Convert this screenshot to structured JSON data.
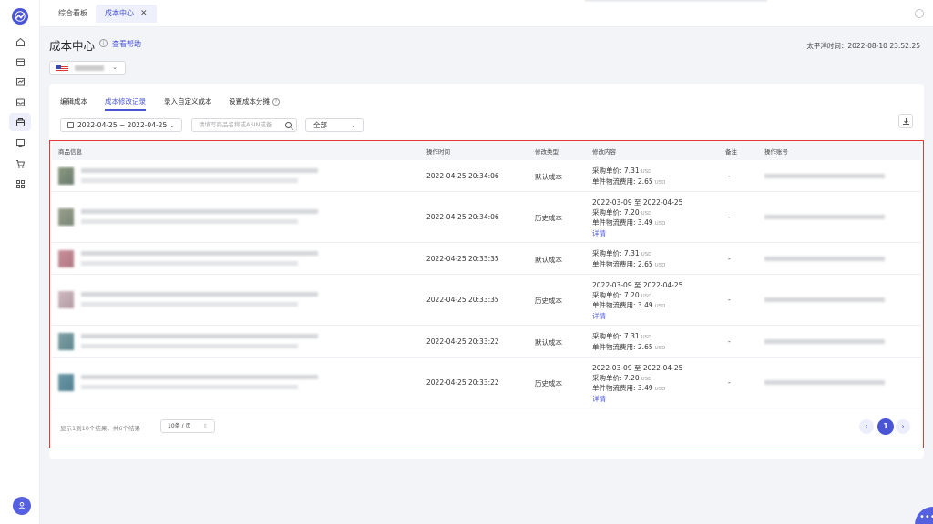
{
  "topbar": {
    "tabs": [
      {
        "label": "综合看板",
        "active": false
      },
      {
        "label": "成本中心",
        "active": true
      }
    ]
  },
  "header": {
    "title": "成本中心",
    "help_link": "查看帮助",
    "timezone_time": "太平洋时间：2022-08-10 23:52:25"
  },
  "subtabs": [
    {
      "label": "编辑成本",
      "active": false
    },
    {
      "label": "成本修改记录",
      "active": true
    },
    {
      "label": "录入自定义成本",
      "active": false
    },
    {
      "label": "设置成本分摊",
      "active": false
    }
  ],
  "filters": {
    "date_range": "2022-04-25 ~ 2022-04-25",
    "search_placeholder": "请填写商品名称或ASIN或备",
    "type_value": "全部"
  },
  "table": {
    "columns": [
      "商品信息",
      "操作时间",
      "修改类型",
      "修改内容",
      "备注",
      "操作账号"
    ],
    "rows": [
      {
        "time": "2022-04-25 20:34:06",
        "type": "默认成本",
        "range": "",
        "purchase_label": "采购单价: 7.31",
        "shipping_label": "单件物流费用: 2.65",
        "currency": "USD",
        "detail": "",
        "note": "-"
      },
      {
        "time": "2022-04-25 20:34:06",
        "type": "历史成本",
        "range": "2022-03-09 至 2022-04-25",
        "purchase_label": "采购单价: 7.20",
        "shipping_label": "单件物流费用: 3.49",
        "currency": "USD",
        "detail": "详情",
        "note": "-"
      },
      {
        "time": "2022-04-25 20:33:35",
        "type": "默认成本",
        "range": "",
        "purchase_label": "采购单价: 7.31",
        "shipping_label": "单件物流费用: 2.65",
        "currency": "USD",
        "detail": "",
        "note": "-"
      },
      {
        "time": "2022-04-25 20:33:35",
        "type": "历史成本",
        "range": "2022-03-09 至 2022-04-25",
        "purchase_label": "采购单价: 7.20",
        "shipping_label": "单件物流费用: 3.49",
        "currency": "USD",
        "detail": "详情",
        "note": "-"
      },
      {
        "time": "2022-04-25 20:33:22",
        "type": "默认成本",
        "range": "",
        "purchase_label": "采购单价: 7.31",
        "shipping_label": "单件物流费用: 2.65",
        "currency": "USD",
        "detail": "",
        "note": "-"
      },
      {
        "time": "2022-04-25 20:33:22",
        "type": "历史成本",
        "range": "2022-03-09 至 2022-04-25",
        "purchase_label": "采购单价: 7.20",
        "shipping_label": "单件物流费用: 3.49",
        "currency": "USD",
        "detail": "详情",
        "note": "-"
      }
    ]
  },
  "pagination": {
    "summary": "显示1到10个结果，共6个结果",
    "page_size": "10条 / 页",
    "current_page": "1",
    "prev_icon": "‹",
    "next_icon": "›"
  },
  "colors": {
    "accent": "#4a55d6",
    "highlight_frame": "#e53935"
  }
}
